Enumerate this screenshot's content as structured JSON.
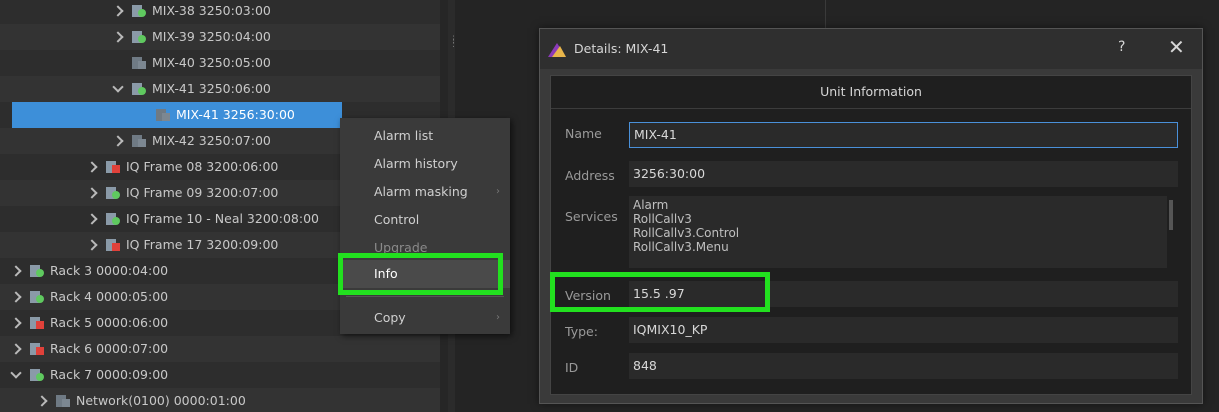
{
  "tree": {
    "rows": [
      {
        "label": "MIX-38 3250:03:00",
        "status": "green",
        "indent": 112,
        "chev": "right",
        "alt": false,
        "sel": false
      },
      {
        "label": "MIX-39 3250:04:00",
        "status": "green",
        "indent": 112,
        "chev": "right",
        "alt": true,
        "sel": false
      },
      {
        "label": "MIX-40 3250:05:00",
        "status": "grey",
        "indent": 112,
        "chev": "none",
        "alt": false,
        "sel": false
      },
      {
        "label": "MIX-41 3250:06:00",
        "status": "green",
        "indent": 112,
        "chev": "down",
        "alt": true,
        "sel": false
      },
      {
        "label": "MIX-41 3256:30:00",
        "status": "grey",
        "indent": 136,
        "chev": "none",
        "alt": false,
        "sel": true
      },
      {
        "label": "MIX-42 3250:07:00",
        "status": "grey",
        "indent": 112,
        "chev": "right",
        "alt": true,
        "sel": false
      },
      {
        "label": "IQ Frame 08 3200:06:00",
        "status": "red",
        "indent": 86,
        "chev": "right",
        "alt": false,
        "sel": false
      },
      {
        "label": "IQ Frame 09 3200:07:00",
        "status": "green",
        "indent": 86,
        "chev": "right",
        "alt": true,
        "sel": false
      },
      {
        "label": "IQ Frame 10 - Neal 3200:08:00",
        "status": "green",
        "indent": 86,
        "chev": "right",
        "alt": false,
        "sel": false
      },
      {
        "label": "IQ Frame 17 3200:09:00",
        "status": "red",
        "indent": 86,
        "chev": "right",
        "alt": true,
        "sel": false
      },
      {
        "label": "Rack 3 0000:04:00",
        "status": "green",
        "indent": 10,
        "chev": "right",
        "alt": false,
        "sel": false
      },
      {
        "label": "Rack 4 0000:05:00",
        "status": "green",
        "indent": 10,
        "chev": "right",
        "alt": true,
        "sel": false
      },
      {
        "label": "Rack 5 0000:06:00",
        "status": "red",
        "indent": 10,
        "chev": "right",
        "alt": false,
        "sel": false
      },
      {
        "label": "Rack 6 0000:07:00",
        "status": "red",
        "indent": 10,
        "chev": "right",
        "alt": true,
        "sel": false
      },
      {
        "label": "Rack 7 0000:09:00",
        "status": "green",
        "indent": 10,
        "chev": "down",
        "alt": false,
        "sel": false
      },
      {
        "label": "Network(0100) 0000:01:00",
        "status": "grey",
        "indent": 36,
        "chev": "right",
        "alt": true,
        "sel": false
      }
    ]
  },
  "menu": {
    "items": [
      {
        "label": "Alarm list",
        "submenu": false
      },
      {
        "label": "Alarm history",
        "submenu": false
      },
      {
        "label": "Alarm masking",
        "submenu": true
      },
      {
        "label": "Control",
        "submenu": false
      },
      {
        "label": "Upgrade",
        "submenu": false
      },
      {
        "label": "Info",
        "submenu": false
      },
      {
        "label": "Copy",
        "submenu": true
      }
    ]
  },
  "dialog": {
    "title": "Details: MIX-41",
    "help": "?",
    "close": "✕",
    "section_title": "Unit Information",
    "name_label": "Name",
    "name_value": "MIX-41",
    "address_label": "Address",
    "address_value": "3256:30:00",
    "services_label": "Services",
    "services": [
      "Alarm",
      "RollCallv3",
      "RollCallv3.Control",
      "RollCallv3.Menu"
    ],
    "version_label": "Version",
    "version_value": "15.5 .97",
    "type_label": "Type:",
    "type_value": "IQMIX10_KP",
    "id_label": "ID",
    "id_value": "848"
  },
  "colors": {
    "highlight": "#22e01f",
    "selection": "#3d8fd9"
  }
}
